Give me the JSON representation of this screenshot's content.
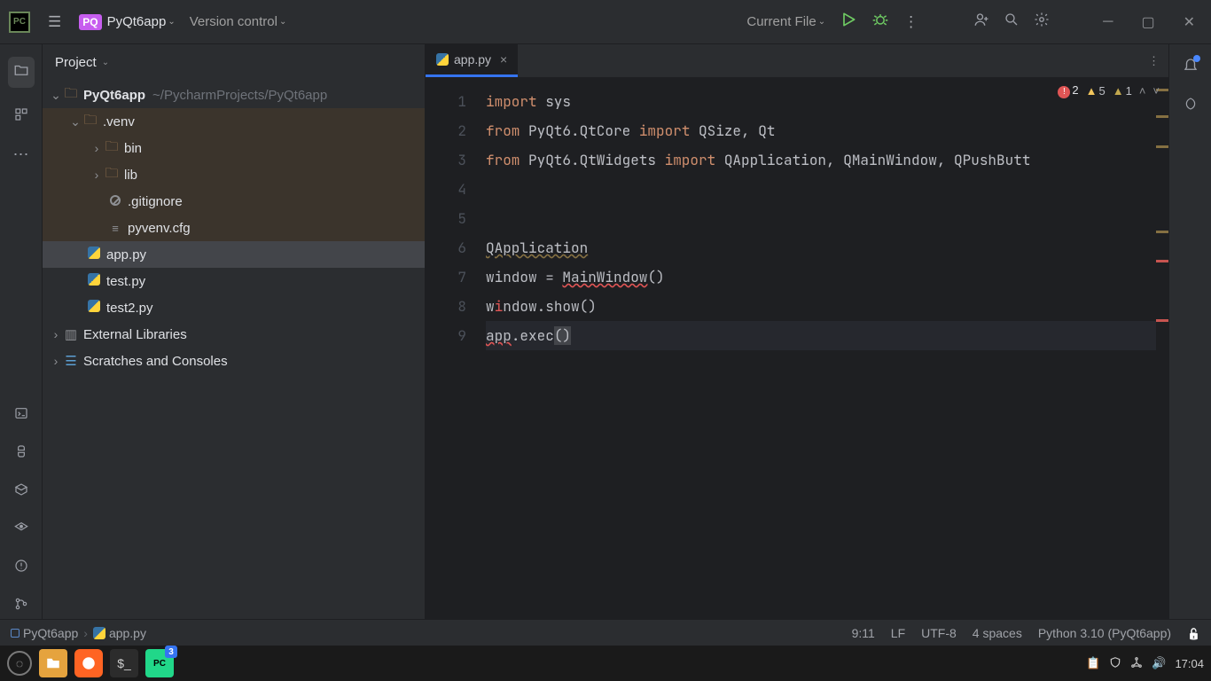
{
  "titlebar": {
    "project_code": "PQ",
    "project_name": "PyQt6app",
    "vcs_label": "Version control",
    "run_config": "Current File"
  },
  "project_panel": {
    "title": "Project",
    "root": {
      "name": "PyQt6app",
      "path": "~/PycharmProjects/PyQt6app"
    },
    "venv": {
      "name": ".venv",
      "bin": "bin",
      "lib": "lib",
      "gitignore": ".gitignore",
      "pyvenv": "pyvenv.cfg"
    },
    "files": {
      "app": "app.py",
      "test": "test.py",
      "test2": "test2.py"
    },
    "external": "External Libraries",
    "scratches": "Scratches and Consoles"
  },
  "tabs": {
    "active": "app.py"
  },
  "inspections": {
    "errors": "2",
    "warnings": "5",
    "weak": "1"
  },
  "code_lines": [
    "1",
    "2",
    "3",
    "4",
    "5",
    "6",
    "7",
    "8",
    "9"
  ],
  "code": {
    "l1_kw": "import",
    "l1_b": " sys",
    "l2_kw1": "from",
    "l2_m": " PyQt6.QtCore ",
    "l2_kw2": "import",
    "l2_b": " QSize, Qt",
    "l3_kw1": "from",
    "l3_m": " PyQt6.QtWidgets ",
    "l3_kw2": "import",
    "l3_b": " QApplication, QMainWindow, QPushButt",
    "l6": "QApplication",
    "l7a": "window = ",
    "l7_unr": "MainWindow",
    "l7b": "()",
    "l8": "window.show()",
    "l8_pre": "w",
    "l8_mid": "ndow",
    "l8_post": ".show()",
    "l9a": "app",
    "l9b": ".exec",
    "l9c": "()"
  },
  "navbar": {
    "crumb1": "PyQt6app",
    "crumb2": "app.py",
    "pos": "9:11",
    "le": "LF",
    "enc": "UTF-8",
    "indent": "4 spaces",
    "interp": "Python 3.10 (PyQt6app)"
  },
  "taskbar": {
    "pc_badge": "3",
    "time": "17:04"
  }
}
